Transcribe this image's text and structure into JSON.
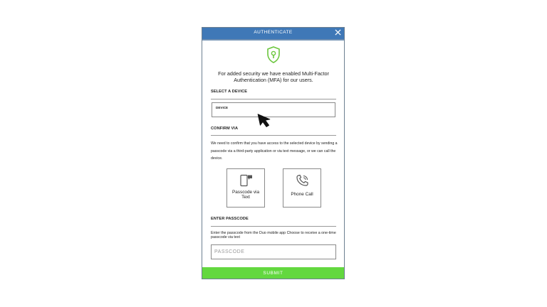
{
  "header": {
    "title": "AUTHENTICATE",
    "close_icon": "close-icon",
    "background_color": "#3f78b7"
  },
  "brand": {
    "shield_icon": "shield-keyhole-icon",
    "accent_color": "#6bc63d"
  },
  "intro": "For added security we have enabled Multi-Factor Authentication (MFA) for our users.",
  "select_device": {
    "label": "SELECT A DEVICE",
    "dropdown_label": "DEVICE"
  },
  "confirm": {
    "label": "CONFIRM VIA",
    "description": "We need to confirm that you have access to the selected device by sending a passcode via a third-party application or via text message, or we can call the device.",
    "methods": [
      {
        "label": "Passcode via Text",
        "icon": "phone-sms-icon"
      },
      {
        "label": "Phone Call",
        "icon": "phone-call-icon"
      }
    ]
  },
  "passcode": {
    "label": "ENTER PASSCODE",
    "instructions": "Enter the passcode from the Duo mobile app Choose to receive a one-time passcode via text",
    "placeholder": "PASSCODE"
  },
  "submit": {
    "label": "SUBMIT",
    "color": "#63d83f"
  },
  "pointer": "mouse-pointer-icon"
}
